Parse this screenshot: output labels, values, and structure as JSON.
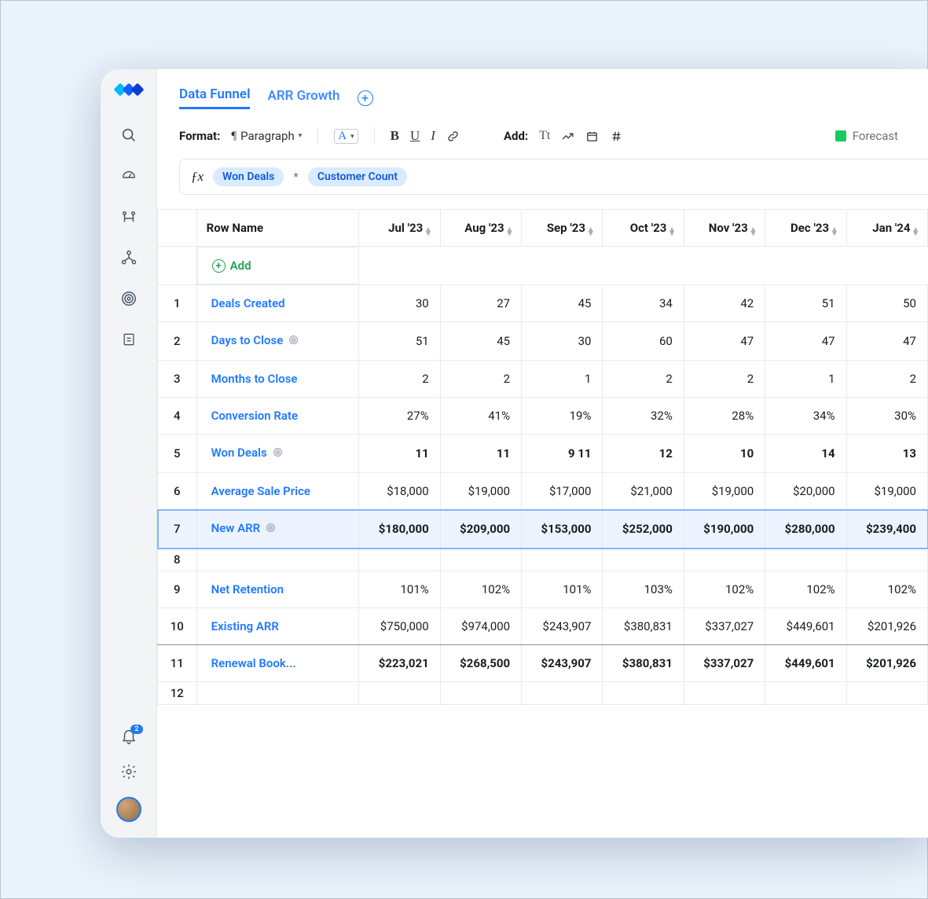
{
  "tabs": {
    "active": "Data Funnel",
    "other": "ARR Growth"
  },
  "toolbar": {
    "format_label": "Format:",
    "paragraph": "Paragraph",
    "add_label": "Add:",
    "forecast": "Forecast"
  },
  "formula": {
    "chip1": "Won Deals",
    "op": "*",
    "chip2": "Customer Count"
  },
  "columns": {
    "rowname": "Row Name",
    "months": [
      "Jul '23",
      "Aug '23",
      "Sep '23",
      "Oct '23",
      "Nov '23",
      "Dec '23",
      "Jan '24"
    ]
  },
  "add_label": "Add",
  "notif_count": "2",
  "rows": [
    {
      "n": "1",
      "name": "Deals Created",
      "vals": [
        "30",
        "27",
        "45",
        "34",
        "42",
        "51",
        "50"
      ],
      "bold": false
    },
    {
      "n": "2",
      "name": "Days to Close",
      "target": true,
      "vals": [
        "51",
        "45",
        "30",
        "60",
        "47",
        "47",
        "47"
      ],
      "bold": false
    },
    {
      "n": "3",
      "name": "Months to Close",
      "vals": [
        "2",
        "2",
        "1",
        "2",
        "2",
        "1",
        "2"
      ],
      "bold": false
    },
    {
      "n": "4",
      "name": "Conversion Rate",
      "vals": [
        "27%",
        "41%",
        "19%",
        "32%",
        "28%",
        "34%",
        "30%"
      ],
      "bold": false
    },
    {
      "n": "5",
      "name": "Won Deals",
      "target": true,
      "vals": [
        "11",
        "11",
        "9  11",
        "12",
        "10",
        "14",
        "13"
      ],
      "bold": true
    },
    {
      "n": "6",
      "name": "Average Sale Price",
      "vals": [
        "$18,000",
        "$19,000",
        "$17,000",
        "$21,000",
        "$19,000",
        "$20,000",
        "$19,000"
      ],
      "bold": false,
      "section_end": true
    },
    {
      "n": "7",
      "name": "New ARR",
      "target": true,
      "hl": true,
      "vals": [
        "$180,000",
        "$209,000",
        "$153,000",
        "$252,000",
        "$190,000",
        "$280,000",
        "$239,400"
      ],
      "bold": true
    },
    {
      "n": "8",
      "name": "",
      "vals": [
        "",
        "",
        "",
        "",
        "",
        "",
        ""
      ],
      "bold": false
    },
    {
      "n": "9",
      "name": "Net Retention",
      "vals": [
        "101%",
        "102%",
        "101%",
        "103%",
        "102%",
        "102%",
        "102%"
      ],
      "bold": false
    },
    {
      "n": "10",
      "name": "Existing ARR",
      "vals": [
        "$750,000",
        "$974,000",
        "$243,907",
        "$380,831",
        "$337,027",
        "$449,601",
        "$201,926"
      ],
      "bold": false,
      "section_end": true
    },
    {
      "n": "11",
      "name": "Renewal Book...",
      "vals": [
        "$223,021",
        "$268,500",
        "$243,907",
        "$380,831",
        "$337,027",
        "$449,601",
        "$201,926"
      ],
      "bold": true
    },
    {
      "n": "12",
      "name": "",
      "vals": [
        "",
        "",
        "",
        "",
        "",
        "",
        ""
      ],
      "bold": false
    }
  ]
}
